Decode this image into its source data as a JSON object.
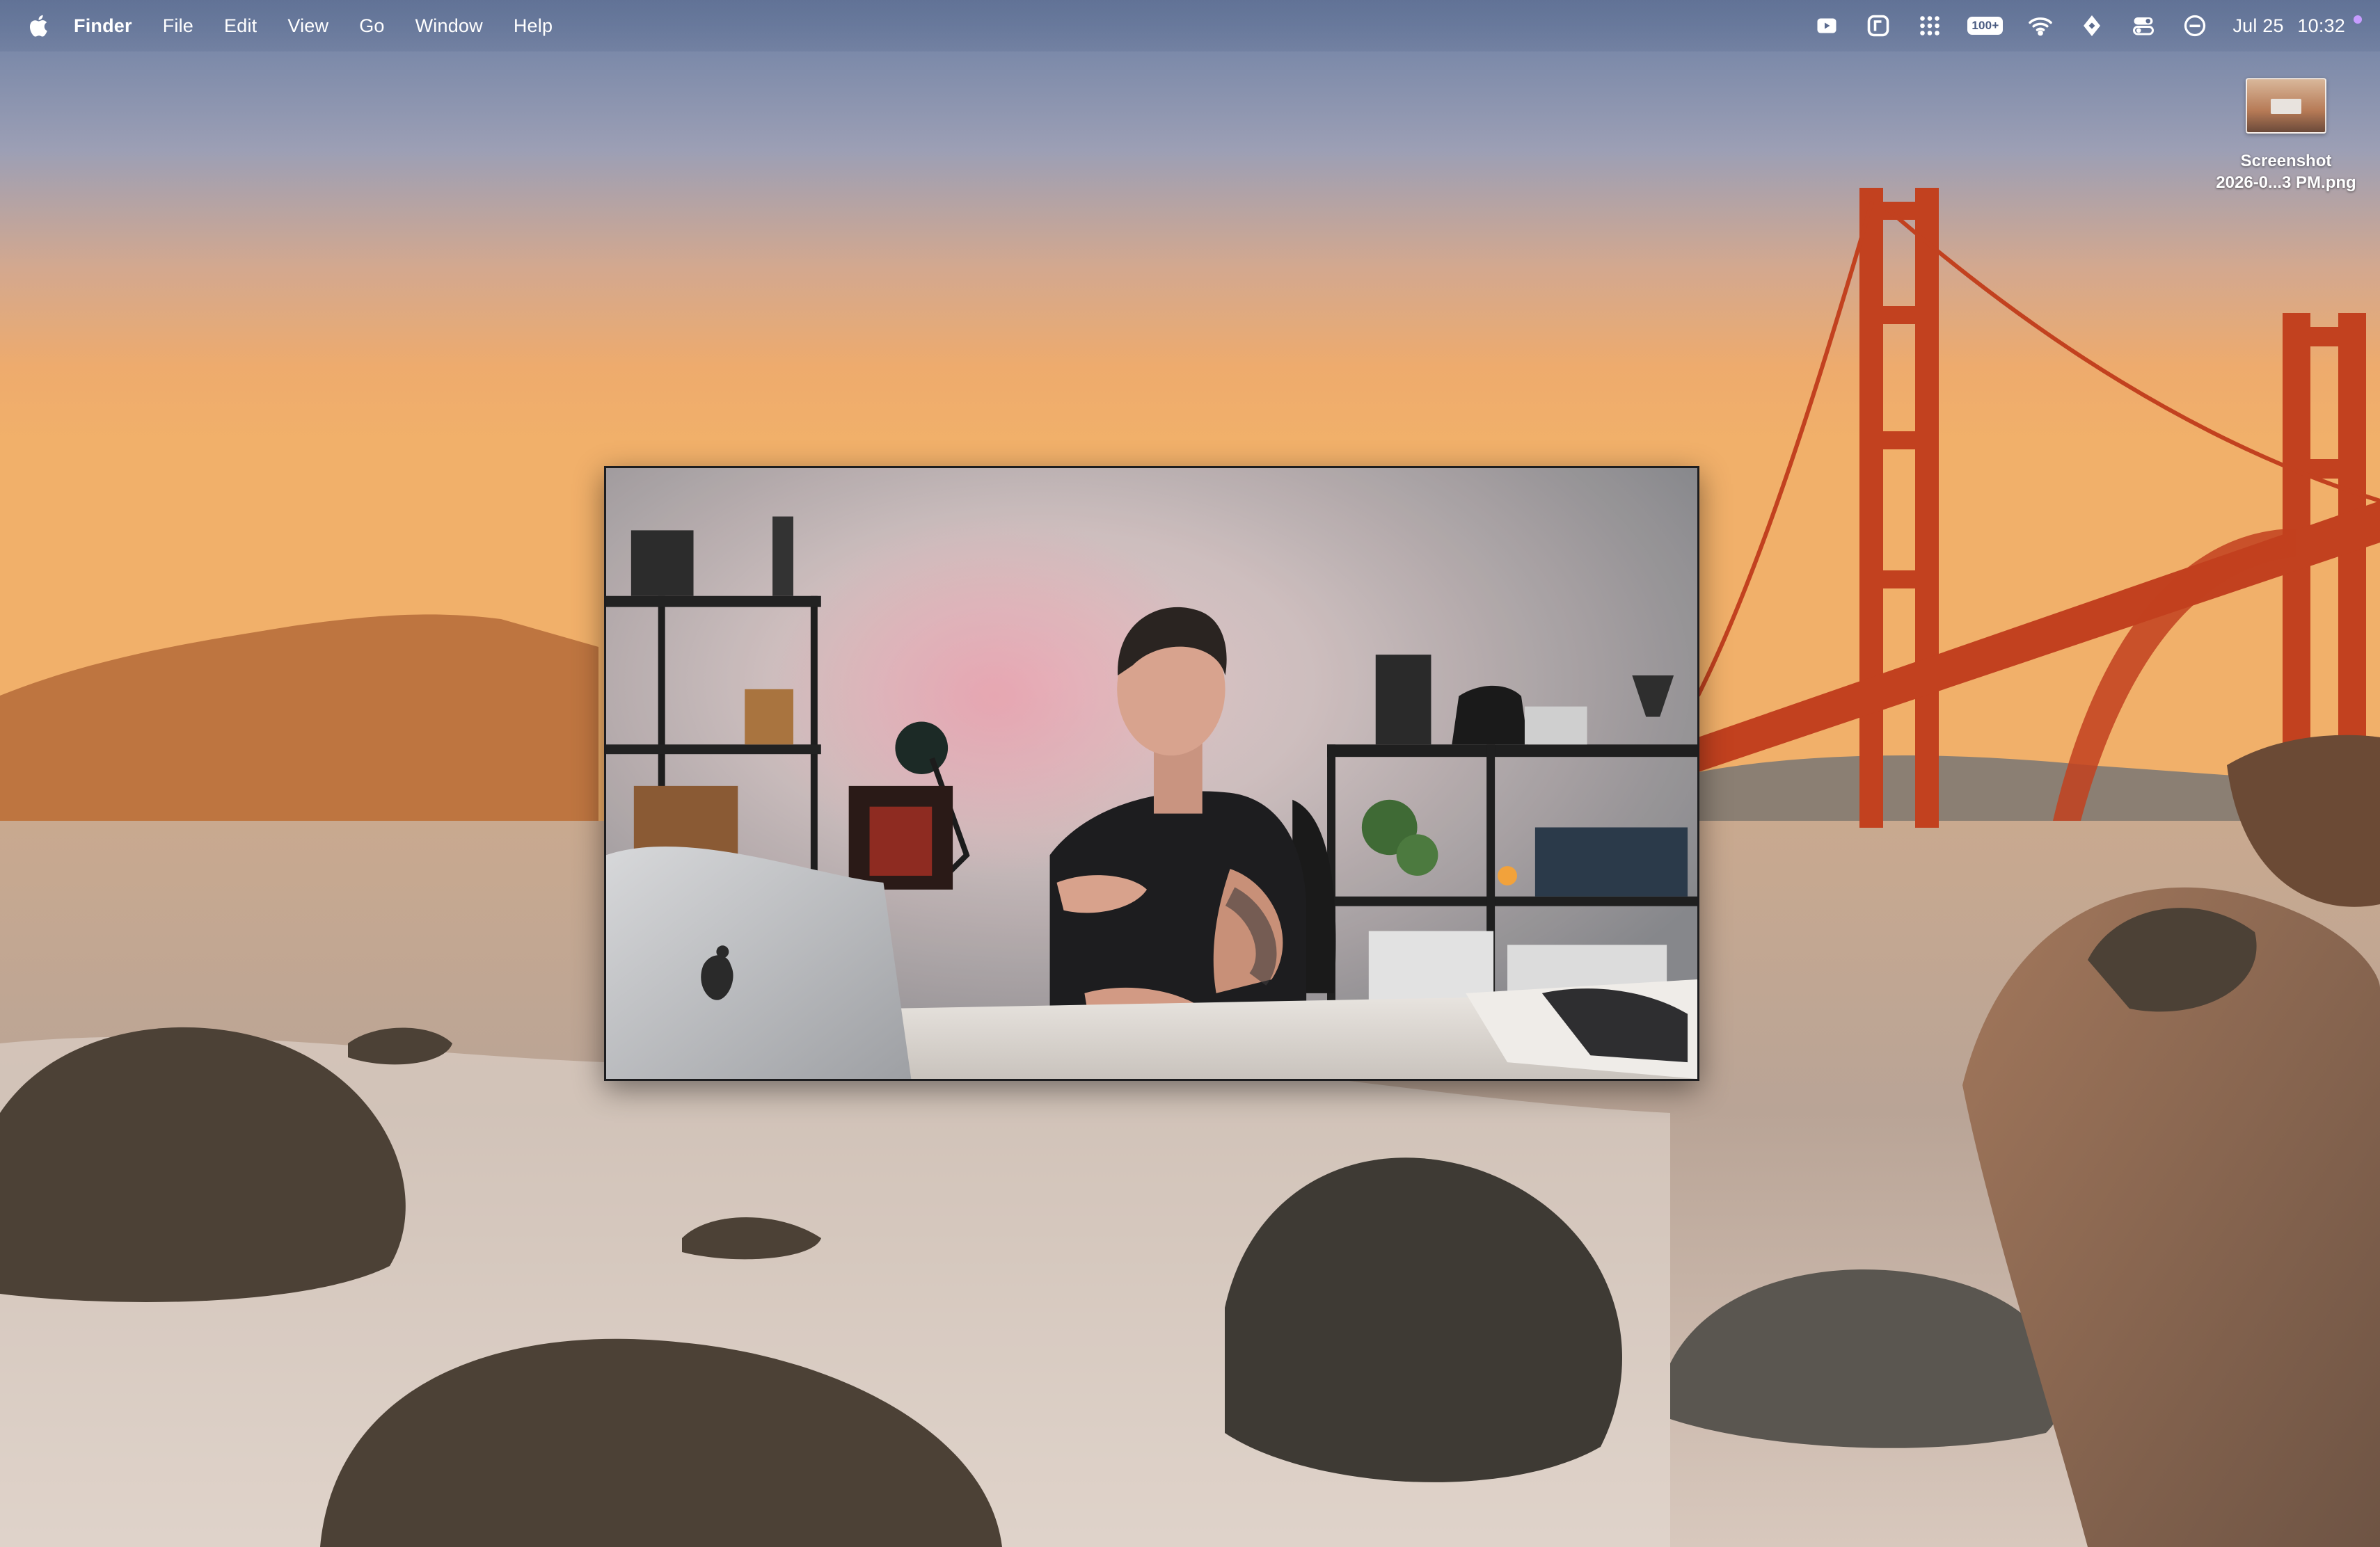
{
  "menubar": {
    "apple_icon": "apple-logo-icon",
    "app_name": "Finder",
    "menus": [
      "File",
      "Edit",
      "View",
      "Go",
      "Window",
      "Help"
    ],
    "status_icons": [
      "youtube-play-icon",
      "app-switcher-icon",
      "grid-dots-icon",
      "battery-icon",
      "wifi-icon",
      "location-icon",
      "control-center-icon",
      "focus-icon"
    ],
    "battery_label": "100+",
    "date": "Jul 25",
    "time": "10:32",
    "recording_indicator_color": "#c79cff"
  },
  "desktop": {
    "file": {
      "name_line1": "Screenshot",
      "name_line2": "2026-0...3 PM.png"
    }
  },
  "video": {
    "description_icon": "video-player-icon"
  }
}
